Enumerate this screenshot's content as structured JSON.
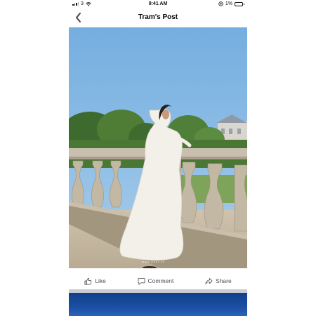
{
  "status_bar": {
    "carrier": "3",
    "time": "9:41 AM",
    "battery": "1%"
  },
  "header": {
    "title": "Tram's Post"
  },
  "post": {
    "watermark": "www.poxi.vn"
  },
  "actions": {
    "like_label": "Like",
    "comment_label": "Comment",
    "share_label": "Share"
  },
  "colors": {
    "sky": "#7db2df",
    "action_text": "#4b4f56",
    "divider": "#c9ccd1"
  }
}
